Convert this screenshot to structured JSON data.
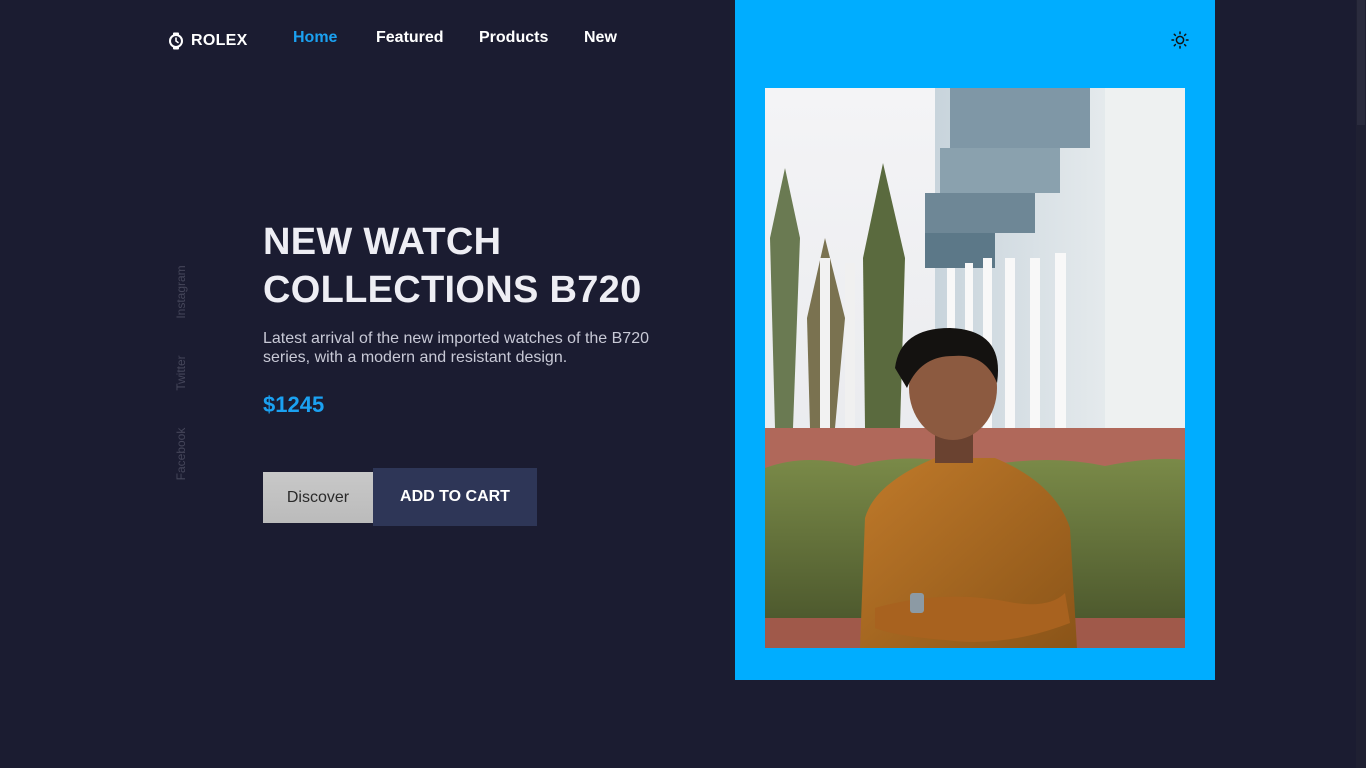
{
  "brand": {
    "name": "ROLEX",
    "icon": "watch-icon"
  },
  "nav": {
    "items": [
      {
        "label": "Home",
        "active": true
      },
      {
        "label": "Featured",
        "active": false
      },
      {
        "label": "Products",
        "active": false
      },
      {
        "label": "New",
        "active": false
      }
    ]
  },
  "theme_toggle": {
    "icon": "sun-icon"
  },
  "social": [
    "Instagram",
    "Twitter",
    "Facebook"
  ],
  "hero": {
    "title_line1": "NEW WATCH",
    "title_line2": "COLLECTIONS B720",
    "description": "Latest arrival of the new imported watches of the B720 series, with a modern and resistant design.",
    "price": "$1245",
    "discover_label": "Discover",
    "cart_label": "ADD TO CART"
  },
  "colors": {
    "background": "#1b1c31",
    "accent": "#1ba1f1",
    "panel": "#00adff",
    "cart_button": "#2e3657"
  }
}
